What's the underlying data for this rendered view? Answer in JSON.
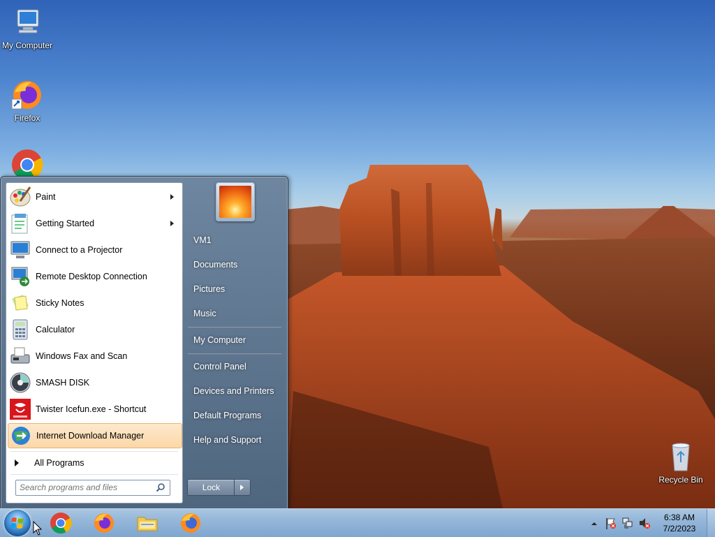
{
  "desktop": {
    "icons": [
      {
        "name": "my-computer",
        "label": "My Computer"
      },
      {
        "name": "firefox",
        "label": "Firefox"
      },
      {
        "name": "chrome",
        "label": ""
      },
      {
        "name": "recycle-bin",
        "label": "Recycle Bin"
      }
    ]
  },
  "start_menu": {
    "programs": [
      {
        "label": "Paint",
        "icon": "paint-icon",
        "has_submenu": true
      },
      {
        "label": "Getting Started",
        "icon": "getting-started-icon",
        "has_submenu": true
      },
      {
        "label": "Connect to a Projector",
        "icon": "projector-icon",
        "has_submenu": false
      },
      {
        "label": "Remote Desktop Connection",
        "icon": "remote-desktop-icon",
        "has_submenu": false
      },
      {
        "label": "Sticky Notes",
        "icon": "sticky-notes-icon",
        "has_submenu": false
      },
      {
        "label": "Calculator",
        "icon": "calculator-icon",
        "has_submenu": false
      },
      {
        "label": "Windows Fax and Scan",
        "icon": "fax-icon",
        "has_submenu": false
      },
      {
        "label": "SMASH DISK",
        "icon": "disk-icon",
        "has_submenu": false
      },
      {
        "label": "Twister Icefun.exe - Shortcut",
        "icon": "twister-icon",
        "has_submenu": false
      },
      {
        "label": "Internet Download Manager",
        "icon": "idm-icon",
        "has_submenu": false,
        "highlighted": true
      }
    ],
    "all_programs": "All Programs",
    "search_placeholder": "Search programs and files",
    "right_links": {
      "user": "VM1",
      "documents": "Documents",
      "pictures": "Pictures",
      "music": "Music",
      "my_computer": "My Computer",
      "control_panel": "Control Panel",
      "devices_printers": "Devices and Printers",
      "default_programs": "Default Programs",
      "help_support": "Help and Support"
    },
    "lock_label": "Lock"
  },
  "taskbar": {
    "pinned": [
      "chrome-icon",
      "firefox-icon",
      "file-explorer-icon",
      "firefox-icon"
    ],
    "time": "6:38 AM",
    "date": "7/2/2023"
  },
  "colors": {
    "highlight": "#fbd7a8",
    "taskbar": "#93b5d8",
    "start_menu_right": "#5a708a"
  }
}
